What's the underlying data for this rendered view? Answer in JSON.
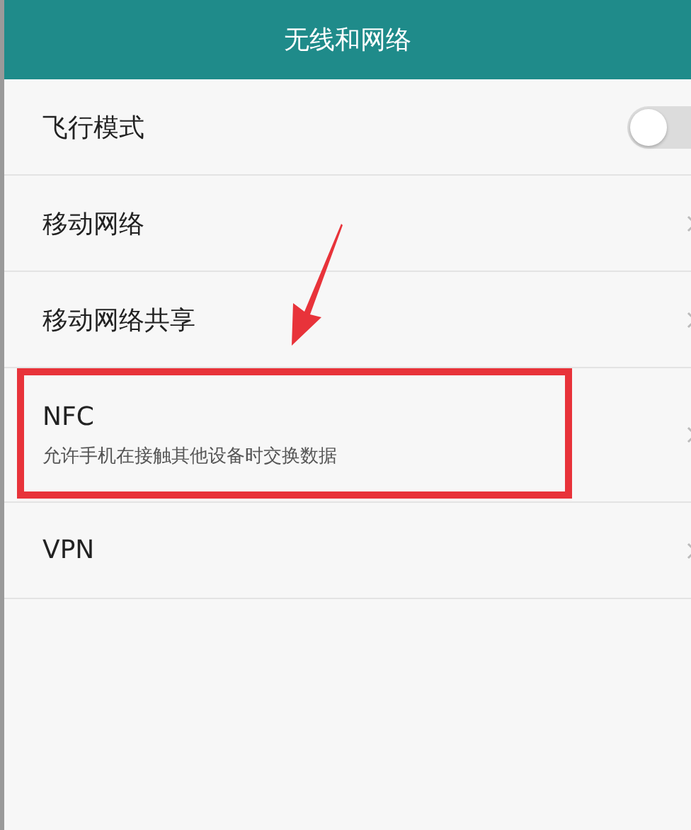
{
  "header": {
    "title": "无线和网络"
  },
  "items": [
    {
      "kind": "toggle",
      "label": "飞行模式",
      "on": false
    },
    {
      "kind": "nav",
      "label": "移动网络"
    },
    {
      "kind": "nav",
      "label": "移动网络共享"
    },
    {
      "kind": "nav",
      "label": "NFC",
      "subtitle": "允许手机在接触其他设备时交换数据",
      "annotated": true
    },
    {
      "kind": "nav",
      "label": "VPN"
    }
  ]
}
